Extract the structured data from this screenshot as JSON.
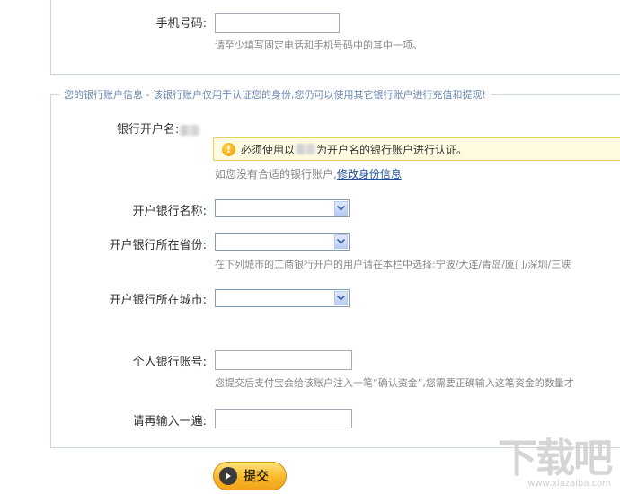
{
  "phone": {
    "label": "手机号码:",
    "value": "",
    "hint": "请至少填写固定电话和手机号码中的其中一项。"
  },
  "bank": {
    "legend": "您的银行账户信息 - 该银行账户仅用于认证您的身份,您仍可以使用其它银行账户进行充值和提现!",
    "account_name_label": "银行开户名:",
    "warning": {
      "icon": "warning-icon",
      "prefix": "必须使用以",
      "suffix": "为开户名的银行账户进行认证。"
    },
    "no_account_text": "如您没有合适的银行账户,",
    "modify_link": "修改身份信息",
    "bank_name_label": "开户银行名称:",
    "province_label": "开户银行所在省份:",
    "province_hint": "在下列城市的工商银行开户的用户请在本栏中选择:宁波/大连/青岛/厦门/深圳/三峡",
    "city_label": "开户银行所在城市:",
    "account_number_label": "个人银行账号:",
    "account_number_value": "",
    "account_hint": "您提交后支付宝会给该账户注入一笔“确认资金”,您需要正确输入这笔资金的数量才",
    "confirm_label": "请再输入一遍:",
    "confirm_value": ""
  },
  "submit": {
    "label": "提交",
    "icon": "play-icon"
  },
  "watermark": {
    "glyphs": "下载吧",
    "url": "www.xiazaiba.com"
  },
  "colors": {
    "accent_link": "#1f4f9e",
    "legend": "#6a87b3",
    "warning_bg": "#fffbe0",
    "button": "#f8b82c"
  }
}
